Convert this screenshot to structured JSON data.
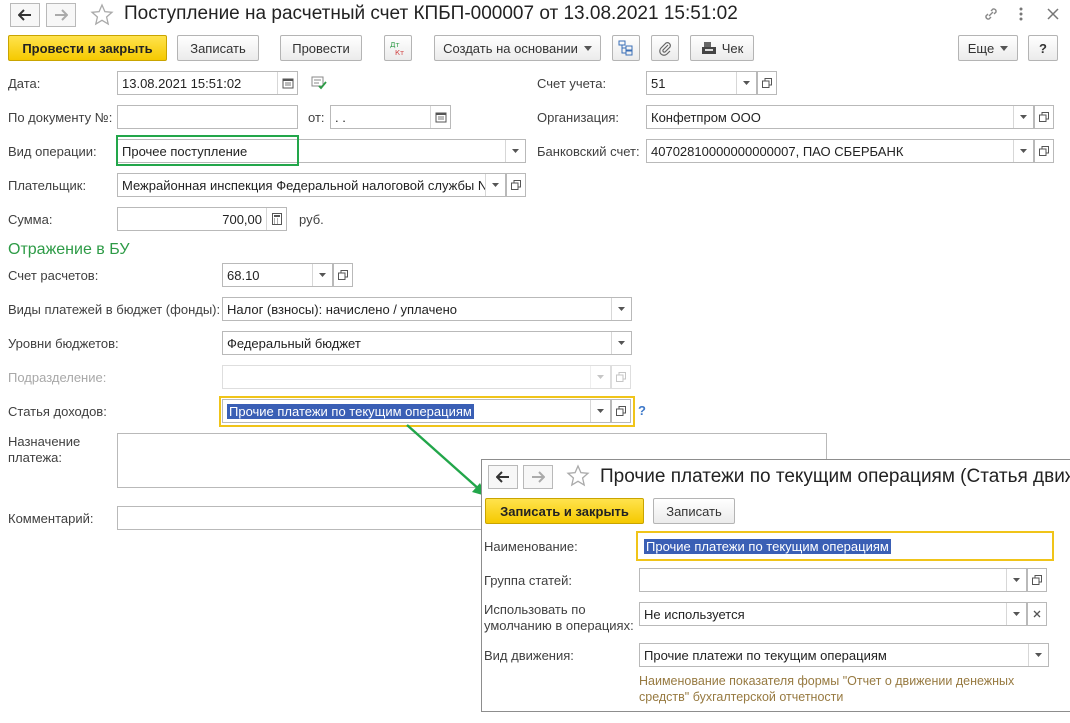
{
  "window": {
    "title": "Поступление на расчетный счет КПБП-000007 от 13.08.2021 15:51:02"
  },
  "toolbar": {
    "post_close": "Провести и закрыть",
    "save": "Записать",
    "post": "Провести",
    "create_based": "Создать на основании",
    "check": "Чек",
    "more": "Еще",
    "help": "?"
  },
  "form": {
    "date_label": "Дата:",
    "date_value": "13.08.2021 15:51:02",
    "doc_no_label": "По документу №:",
    "doc_no_value": "",
    "from_label": "от:",
    "from_value": " .  .",
    "operation_label": "Вид операции:",
    "operation_value": "Прочее поступление",
    "payer_label": "Плательщик:",
    "payer_value": "Межрайонная инспекция Федеральной налоговой службы N",
    "sum_label": "Сумма:",
    "sum_value": "700,00",
    "currency": "руб.",
    "account_label": "Счет учета:",
    "account_value": "51",
    "org_label": "Организация:",
    "org_value": "Конфетпром ООО",
    "bank_label": "Банковский счет:",
    "bank_value": "40702810000000000007, ПАО СБЕРБАНК"
  },
  "bu": {
    "section_title": "Отражение в БУ",
    "settle_label": "Счет расчетов:",
    "settle_value": "68.10",
    "payment_types_label": "Виды платежей в бюджет (фонды):",
    "payment_types_value": "Налог (взносы): начислено / уплачено",
    "levels_label": "Уровни бюджетов:",
    "levels_value": "Федеральный бюджет",
    "division_label": "Подразделение:",
    "division_value": "",
    "income_label": "Статья доходов:",
    "income_value": "Прочие платежи по текущим операциям",
    "help": "?",
    "purpose_label": "Назначение платежа:",
    "comment_label": "Комментарий:"
  },
  "subwindow": {
    "title": "Прочие платежи по текущим операциям (Статья движ",
    "save_close": "Записать и закрыть",
    "save": "Записать",
    "name_label": "Наименование:",
    "name_value": "Прочие платежи по текущим операциям",
    "group_label": "Группа статей:",
    "group_value": "",
    "default_label": "Использовать по умолчанию в операциях:",
    "default_value": "Не используется",
    "movement_label": "Вид движения:",
    "movement_value": "Прочие платежи по текущим операциям",
    "hint": "Наименование показателя формы \"Отчет о движении денежных средств\" бухгалтерской отчетности"
  },
  "colors": {
    "accent_yellow": "#f5c900",
    "section_green": "#2d9b46",
    "highlight_green": "#22a64a",
    "selection_blue": "#3a5fb5"
  }
}
